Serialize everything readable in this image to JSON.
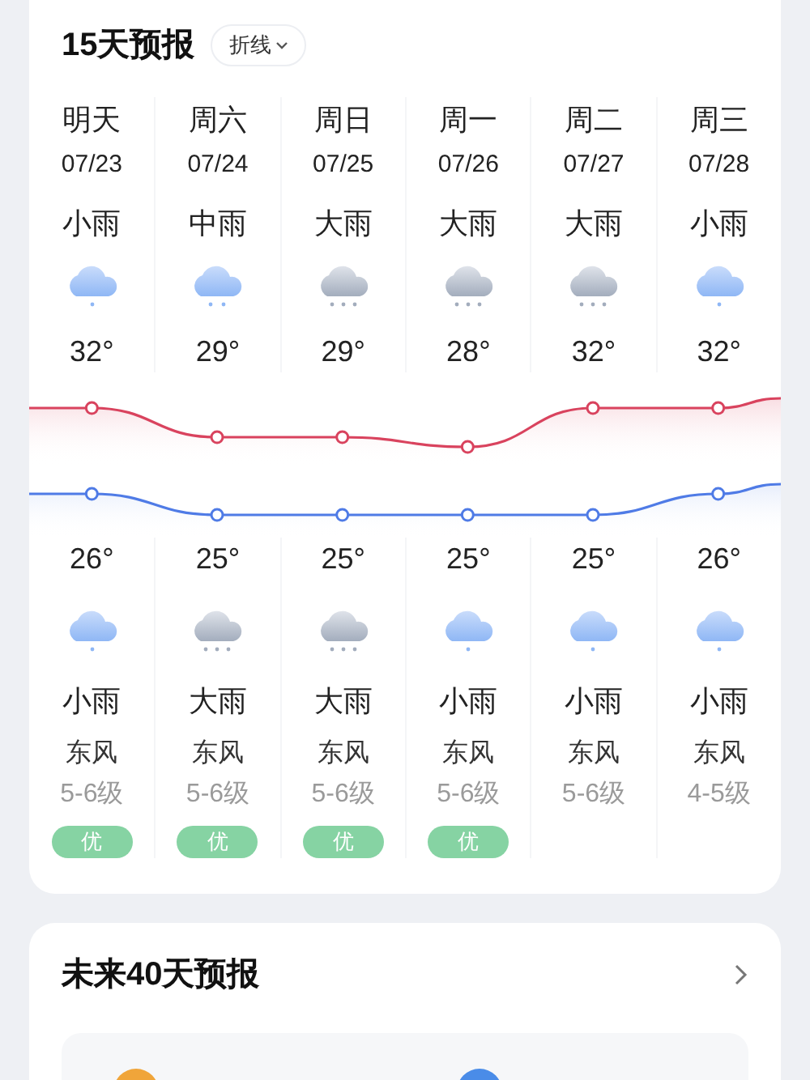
{
  "forecast_15": {
    "title": "15天预报",
    "view_toggle": "折线",
    "days": [
      {
        "day": "明天",
        "date": "07/23",
        "day_weather": "小雨",
        "day_icon": {
          "kind": "light"
        },
        "high": "32°",
        "low": "26°",
        "night_icon": {
          "kind": "light"
        },
        "night_weather": "小雨",
        "wind": "东风",
        "wind_level": "5-6级",
        "aqi": "优"
      },
      {
        "day": "周六",
        "date": "07/24",
        "day_weather": "中雨",
        "day_icon": {
          "kind": "moderate"
        },
        "high": "29°",
        "low": "25°",
        "night_icon": {
          "kind": "heavy"
        },
        "night_weather": "大雨",
        "wind": "东风",
        "wind_level": "5-6级",
        "aqi": "优"
      },
      {
        "day": "周日",
        "date": "07/25",
        "day_weather": "大雨",
        "day_icon": {
          "kind": "heavy"
        },
        "high": "29°",
        "low": "25°",
        "night_icon": {
          "kind": "heavy"
        },
        "night_weather": "大雨",
        "wind": "东风",
        "wind_level": "5-6级",
        "aqi": "优"
      },
      {
        "day": "周一",
        "date": "07/26",
        "day_weather": "大雨",
        "day_icon": {
          "kind": "heavy"
        },
        "high": "28°",
        "low": "25°",
        "night_icon": {
          "kind": "light"
        },
        "night_weather": "小雨",
        "wind": "东风",
        "wind_level": "5-6级",
        "aqi": "优"
      },
      {
        "day": "周二",
        "date": "07/27",
        "day_weather": "大雨",
        "day_icon": {
          "kind": "heavy"
        },
        "high": "32°",
        "low": "25°",
        "night_icon": {
          "kind": "light"
        },
        "night_weather": "小雨",
        "wind": "东风",
        "wind_level": "5-6级"
      },
      {
        "day": "周三",
        "date": "07/28",
        "day_weather": "小雨",
        "day_icon": {
          "kind": "light"
        },
        "high": "32°",
        "low": "26°",
        "night_icon": {
          "kind": "light"
        },
        "night_weather": "小雨",
        "wind": "东风",
        "wind_level": "4-5级"
      }
    ]
  },
  "forecast_40": {
    "title": "未来40天预报"
  }
}
